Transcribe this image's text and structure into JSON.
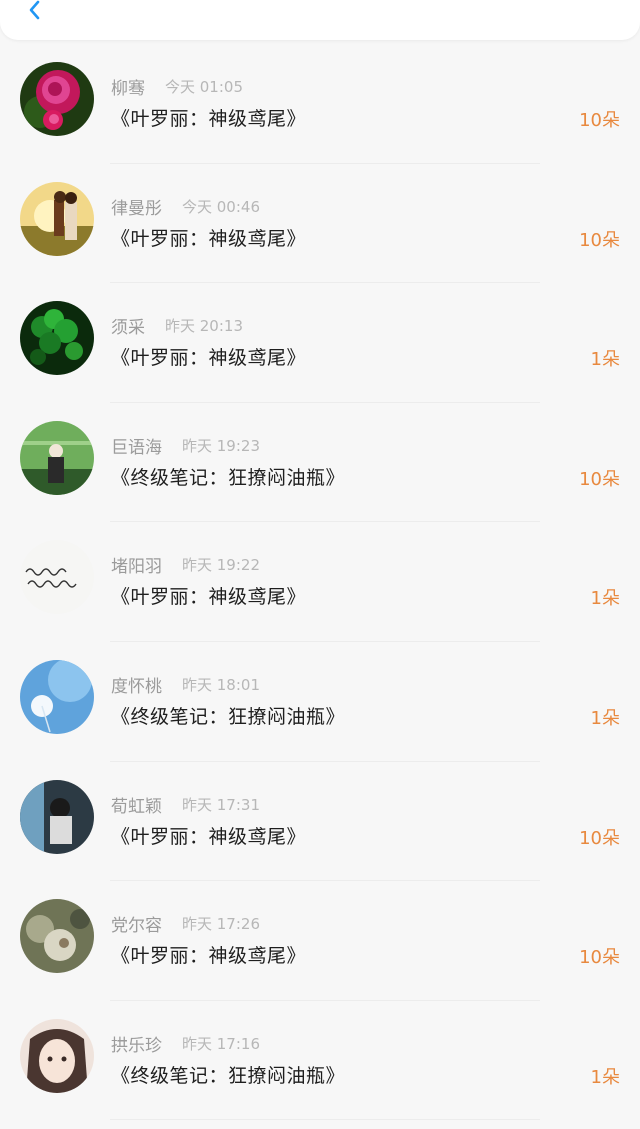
{
  "header": {
    "back_icon": "chevron-left-icon",
    "accent": "#2196f3"
  },
  "colors": {
    "amount": "#e8893f",
    "name": "#9b9b9b",
    "time": "#b7b7b7",
    "title": "#1e1e1e"
  },
  "records": [
    {
      "name": "柳骞",
      "time": "今天 01:05",
      "title": "《叶罗丽：神级鸢尾》",
      "amount": "10朵",
      "avatar": "rose"
    },
    {
      "name": "律曼彤",
      "time": "今天 00:46",
      "title": "《叶罗丽：神级鸢尾》",
      "amount": "10朵",
      "avatar": "sunset-couple"
    },
    {
      "name": "须采",
      "time": "昨天 20:13",
      "title": "《叶罗丽：神级鸢尾》",
      "amount": "1朵",
      "avatar": "green-clover"
    },
    {
      "name": "巨语海",
      "time": "昨天 19:23",
      "title": "《终级笔记：狂撩闷油瓶》",
      "amount": "10朵",
      "avatar": "girl-green"
    },
    {
      "name": "堵阳羽",
      "time": "昨天 19:22",
      "title": "《叶罗丽：神级鸢尾》",
      "amount": "1朵",
      "avatar": "handwriting"
    },
    {
      "name": "度怀桃",
      "time": "昨天 18:01",
      "title": "《终级笔记：狂撩闷油瓶》",
      "amount": "1朵",
      "avatar": "dandelion"
    },
    {
      "name": "荀虹颖",
      "time": "昨天 17:31",
      "title": "《叶罗丽：神级鸢尾》",
      "amount": "10朵",
      "avatar": "girl-window"
    },
    {
      "name": "党尔容",
      "time": "昨天 17:26",
      "title": "《叶罗丽：神级鸢尾》",
      "amount": "10朵",
      "avatar": "blurry-object"
    },
    {
      "name": "拱乐珍",
      "time": "昨天 17:16",
      "title": "《终级笔记：狂撩闷油瓶》",
      "amount": "1朵",
      "avatar": "anime-girl"
    }
  ]
}
